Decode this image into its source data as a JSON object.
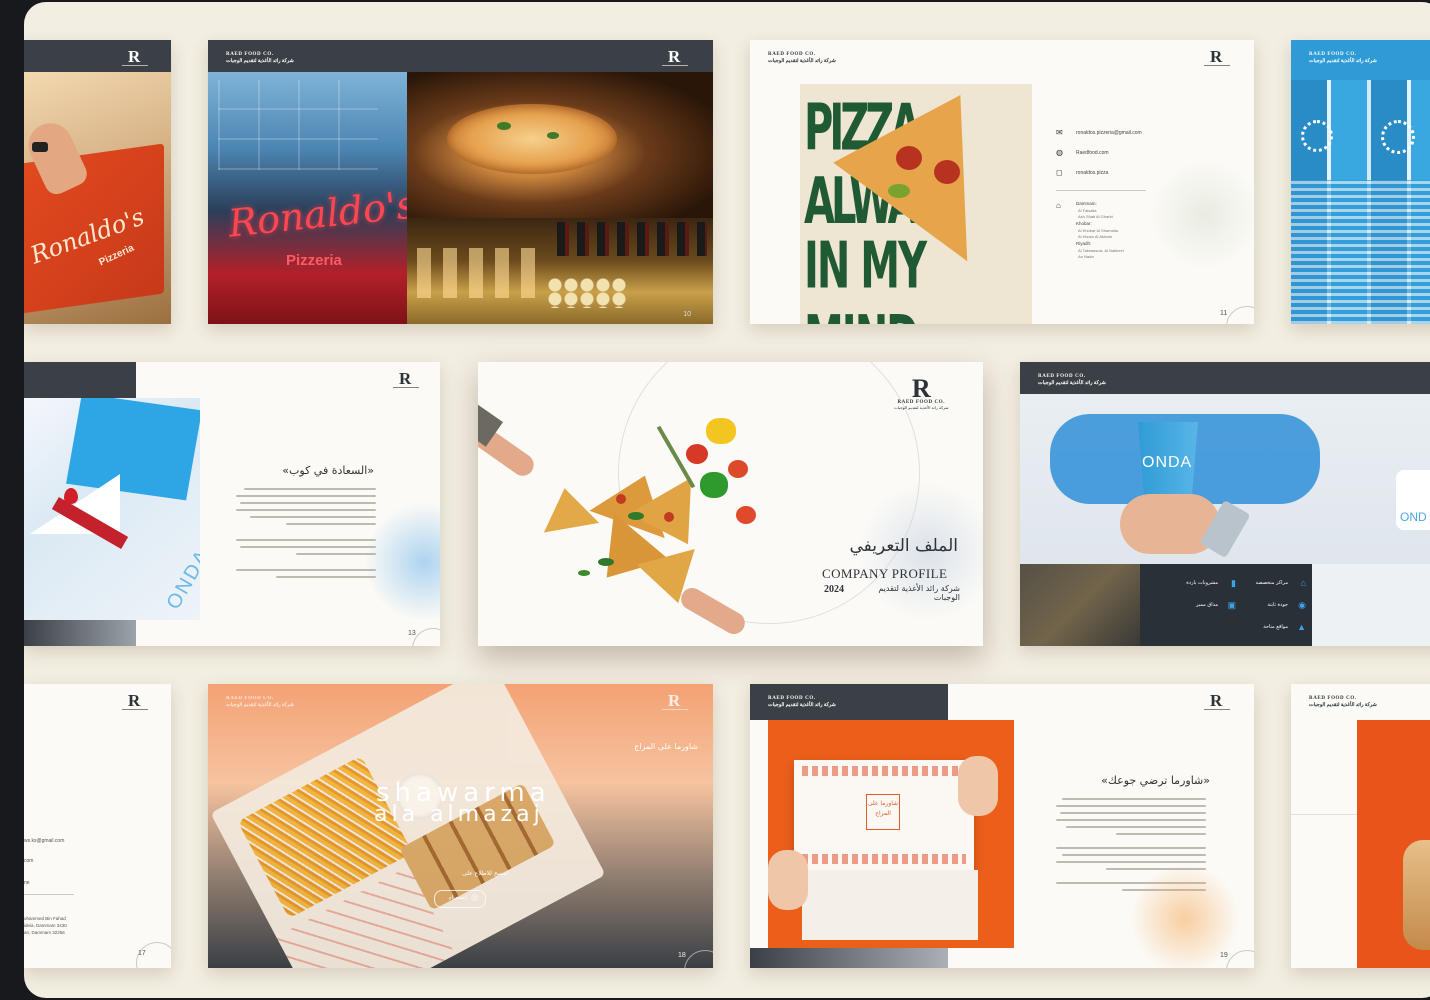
{
  "brand_mark": "R",
  "company": {
    "en": "RAED FOOD CO.",
    "ar": "شركة رائد الأغذية لتقديم الوجبات"
  },
  "cover": {
    "title_ar": "الملف التعريفي",
    "title_en": "COMPANY PROFILE",
    "year": "2024",
    "company_ar": "شركة رائد الأغذية لتقديم الوجبات"
  },
  "ronaldos": {
    "sign": "Ronaldo's",
    "sub": "Pizzeria",
    "box_sign": "Ronaldo's",
    "box_sub": "Pizzeria"
  },
  "pizza_slide": {
    "headline_1": "PIZZA ALWAYS",
    "headline_2": "IN MY MIND",
    "contacts": [
      {
        "icon": "mail-icon",
        "text": "ronaldos.pizzeria@gmail.com"
      },
      {
        "icon": "globe-icon",
        "text": "Raedfood.com"
      },
      {
        "icon": "instagram-icon",
        "text": "ronaldos.pizza"
      }
    ],
    "branches_label": "Dammam:",
    "branches": [
      "Al Faisalia",
      "Ash Shati Al Gharbi",
      "Khobar:",
      "Al Khobar Al Shamalia",
      "Al Hizam Al Akhdar",
      "Riyadh:",
      "Al Takhassusi, Al Nakheel",
      "An Nada"
    ],
    "page": "11"
  },
  "onda_slide": {
    "heading_ar": "«السعادة في كوب»",
    "cup_text": "ONDA",
    "page": "13"
  },
  "onda_features": {
    "cup_text": "ONDA",
    "cup_text_2": "OND",
    "items": [
      {
        "icon": "location-icon",
        "label": "مواقع متاحة"
      },
      {
        "icon": "star-icon",
        "label": "جودة ثابتة"
      },
      {
        "icon": "coffee-icon",
        "label": "مذاق مميز"
      },
      {
        "icon": "cup-icon",
        "label": "مشروبات باردة"
      },
      {
        "icon": "store-icon",
        "label": "مراكز متخصصة"
      }
    ]
  },
  "shawarma_slide": {
    "title_1": "SHawarma",
    "title_2": "ala almazaj",
    "subtitle_ar": "شاورما على المزاج",
    "cta_ar": "امسح للاطلاع على",
    "handle": "إنستغرام",
    "page": "18"
  },
  "shawarma_text_slide": {
    "heading_ar": "«شاورما ترضي جوعك»",
    "box_text": "شاورما على المزاج",
    "page": "19"
  },
  "contact_slide": {
    "email": "ws.ks@gmail.com",
    "web": "com",
    "social": "ne",
    "address_1": "ohammed Bin Fahad",
    "address_2": "ideia, Dammam 3430",
    "address_3": "an, Dammam 32256",
    "page": "17"
  },
  "pizzeria_slide": {
    "page": "10"
  },
  "colors": {
    "dark_band": "#3b4046",
    "canvas": "#f3eee2",
    "pizza_green": "#1f5a34",
    "onda_blue": "#2f9bd6",
    "shawarma_orange": "#f08a3a"
  }
}
